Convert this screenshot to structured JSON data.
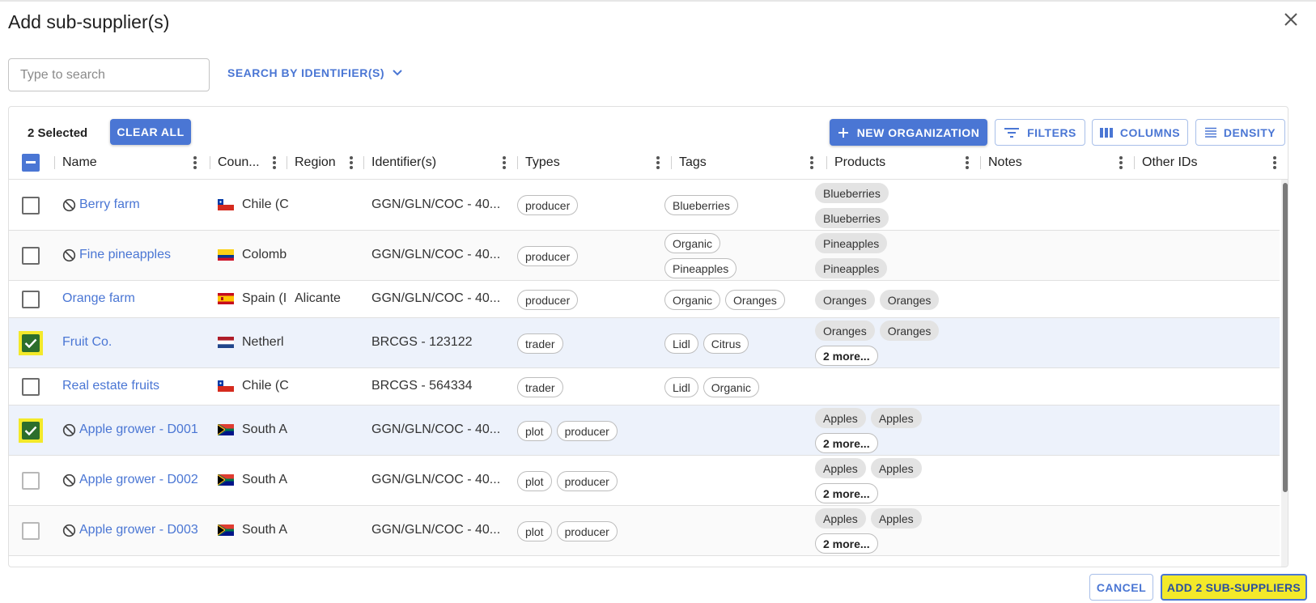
{
  "dialog": {
    "title": "Add sub-supplier(s)",
    "search_placeholder": "Type to search",
    "search_by_label": "SEARCH BY IDENTIFIER(S)"
  },
  "toolbar": {
    "selected_count": "2 Selected",
    "clear_all": "CLEAR ALL",
    "new_organization": "NEW ORGANIZATION",
    "filters": "FILTERS",
    "columns": "COLUMNS",
    "density": "DENSITY"
  },
  "columns": [
    "Name",
    "Coun...",
    "Region",
    "Identifier(s)",
    "Types",
    "Tags",
    "Products",
    "Notes",
    "Other IDs"
  ],
  "rows": [
    {
      "name": "Berry farm",
      "icon": "no-entry-icon",
      "country": "Chile (C",
      "flag": "chile",
      "region": "",
      "identifier": "GGN/GLN/COC - 40...",
      "types": [
        "producer"
      ],
      "tags": [
        [
          "Blueberries"
        ]
      ],
      "products": [
        [
          "Blueberries"
        ],
        [
          "Blueberries"
        ]
      ],
      "checked": false,
      "highlight": false
    },
    {
      "name": "Fine pineapples",
      "icon": "no-entry-icon",
      "country": "Colomb",
      "flag": "colombia",
      "region": "",
      "identifier": "GGN/GLN/COC - 40...",
      "types": [
        "producer"
      ],
      "tags": [
        [
          "Organic"
        ],
        [
          "Pineapples"
        ]
      ],
      "products": [
        [
          "Pineapples"
        ],
        [
          "Pineapples"
        ]
      ],
      "checked": false,
      "highlight": false
    },
    {
      "name": "Orange farm",
      "icon": "",
      "country": "Spain (I",
      "flag": "spain",
      "region": "Alicante",
      "identifier": "GGN/GLN/COC - 40...",
      "types": [
        "producer"
      ],
      "tags": [
        [
          "Organic",
          "Oranges"
        ]
      ],
      "products": [
        [
          "Oranges",
          "Oranges"
        ]
      ],
      "checked": false,
      "highlight": false
    },
    {
      "name": "Fruit Co.",
      "icon": "",
      "country": "Netherl",
      "flag": "netherlands",
      "region": "",
      "identifier": "BRCGS - 123122",
      "types": [
        "trader"
      ],
      "tags": [
        [
          "Lidl",
          "Citrus"
        ]
      ],
      "products": [
        [
          "Oranges",
          "Oranges"
        ]
      ],
      "more": "2 more...",
      "checked": true,
      "highlight": true
    },
    {
      "name": "Real estate fruits",
      "icon": "",
      "country": "Chile (C",
      "flag": "chile",
      "region": "",
      "identifier": "BRCGS - 564334",
      "types": [
        "trader"
      ],
      "tags": [
        [
          "Lidl",
          "Organic"
        ]
      ],
      "products": [],
      "checked": false,
      "highlight": false
    },
    {
      "name": "Apple grower - D001",
      "icon": "no-entry-icon",
      "country": "South A",
      "flag": "south-africa",
      "region": "",
      "identifier": "GGN/GLN/COC - 40...",
      "types": [
        "plot",
        "producer"
      ],
      "tags": [],
      "products": [
        [
          "Apples",
          "Apples"
        ]
      ],
      "more": "2 more...",
      "checked": true,
      "highlight": true
    },
    {
      "name": "Apple grower - D002",
      "icon": "no-entry-icon",
      "country": "South A",
      "flag": "south-africa",
      "region": "",
      "identifier": "GGN/GLN/COC - 40...",
      "types": [
        "plot",
        "producer"
      ],
      "tags": [],
      "products": [
        [
          "Apples",
          "Apples"
        ]
      ],
      "more": "2 more...",
      "checked": false,
      "highlight": false,
      "light": true
    },
    {
      "name": "Apple grower - D003",
      "icon": "no-entry-icon",
      "country": "South A",
      "flag": "south-africa",
      "region": "",
      "identifier": "GGN/GLN/COC - 40...",
      "types": [
        "plot",
        "producer"
      ],
      "tags": [],
      "products": [
        [
          "Apples",
          "Apples"
        ]
      ],
      "more": "2 more...",
      "checked": false,
      "highlight": false,
      "light": true
    }
  ],
  "footer": {
    "cancel": "CANCEL",
    "add": "ADD 2 SUB-SUPPLIERS"
  },
  "colors": {
    "accent": "#4a76d4",
    "highlight": "#f3e92a",
    "check_green": "#2c6e2c"
  }
}
